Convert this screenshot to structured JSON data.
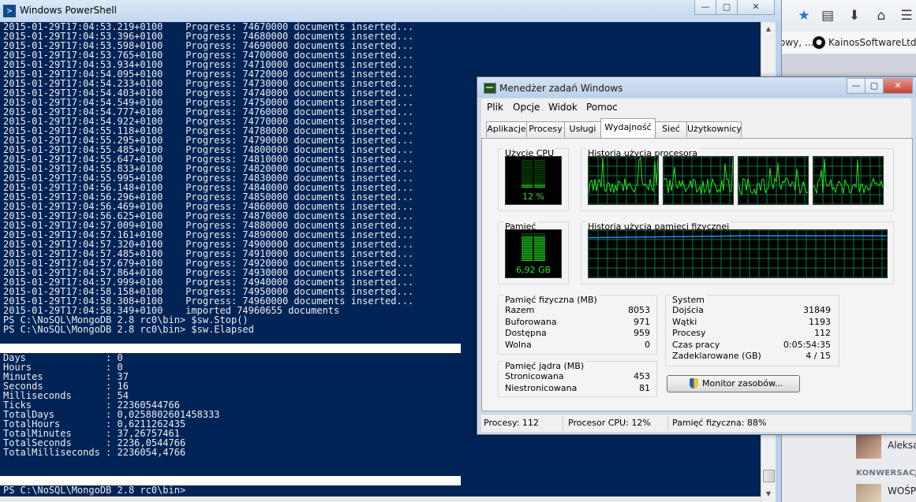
{
  "browser": {
    "bookmark_prefix": "owy, ...",
    "bookmark_github": "KainosSoftwareLtd/t",
    "chat_name_1": "Aleksa",
    "chat_section": "KONWERSACJ",
    "chat_name_2": "WOŚP"
  },
  "powershell": {
    "title": "Windows PowerShell",
    "progress_lines": [
      "2015-01-29T17:04:53.219+0100    Progress: 74670000 documents inserted...",
      "2015-01-29T17:04:53.396+0100    Progress: 74680000 documents inserted...",
      "2015-01-29T17:04:53.598+0100    Progress: 74690000 documents inserted...",
      "2015-01-29T17:04:53.765+0100    Progress: 74700000 documents inserted...",
      "2015-01-29T17:04:53.934+0100    Progress: 74710000 documents inserted...",
      "2015-01-29T17:04:54.095+0100    Progress: 74720000 documents inserted...",
      "2015-01-29T17:04:54.233+0100    Progress: 74730000 documents inserted...",
      "2015-01-29T17:04:54.403+0100    Progress: 74740000 documents inserted...",
      "2015-01-29T17:04:54.549+0100    Progress: 74750000 documents inserted...",
      "2015-01-29T17:04:54.777+0100    Progress: 74760000 documents inserted...",
      "2015-01-29T17:04:54.922+0100    Progress: 74770000 documents inserted...",
      "2015-01-29T17:04:55.118+0100    Progress: 74780000 documents inserted...",
      "2015-01-29T17:04:55.295+0100    Progress: 74790000 documents inserted...",
      "2015-01-29T17:04:55.485+0100    Progress: 74800000 documents inserted...",
      "2015-01-29T17:04:55.647+0100    Progress: 74810000 documents inserted...",
      "2015-01-29T17:04:55.833+0100    Progress: 74820000 documents inserted...",
      "2015-01-29T17:04:55.995+0100    Progress: 74830000 documents inserted...",
      "2015-01-29T17:04:56.148+0100    Progress: 74840000 documents inserted...",
      "2015-01-29T17:04:56.296+0100    Progress: 74850000 documents inserted...",
      "2015-01-29T17:04:56.469+0100    Progress: 74860000 documents inserted...",
      "2015-01-29T17:04:56.625+0100    Progress: 74870000 documents inserted...",
      "2015-01-29T17:04:57.009+0100    Progress: 74880000 documents inserted...",
      "2015-01-29T17:04:57.161+0100    Progress: 74890000 documents inserted...",
      "2015-01-29T17:04:57.320+0100    Progress: 74900000 documents inserted...",
      "2015-01-29T17:04:57.485+0100    Progress: 74910000 documents inserted...",
      "2015-01-29T17:04:57.679+0100    Progress: 74920000 documents inserted...",
      "2015-01-29T17:04:57.864+0100    Progress: 74930000 documents inserted...",
      "2015-01-29T17:04:57.999+0100    Progress: 74940000 documents inserted...",
      "2015-01-29T17:04:58.158+0100    Progress: 74950000 documents inserted...",
      "2015-01-29T17:04:58.308+0100    Progress: 74960000 documents inserted...",
      "2015-01-29T17:04:58.349+0100    imported 74960655 documents"
    ],
    "cmd_stop": "PS C:\\NoSQL\\MongoDB 2.8 rc0\\bin> $sw.Stop()",
    "cmd_elapsed": "PS C:\\NoSQL\\MongoDB 2.8 rc0\\bin> $sw.Elapsed",
    "elapsed_lines": [
      "Days              : 0",
      "Hours             : 0",
      "Minutes           : 37",
      "Seconds           : 16",
      "Milliseconds      : 54",
      "Ticks             : 22360544766",
      "TotalDays         : 0,0258802601458333",
      "TotalHours        : 0,6211262435",
      "TotalMinutes      : 37,26757461",
      "TotalSeconds      : 2236,0544766",
      "TotalMilliseconds : 2236054,4766"
    ],
    "prompt": "PS C:\\NoSQL\\MongoDB 2.8 rc0\\bin>"
  },
  "taskmanager": {
    "title": "Menedżer zadań Windows",
    "menu": [
      "Plik",
      "Opcje",
      "Widok",
      "Pomoc"
    ],
    "tabs": [
      "Aplikacje",
      "Procesy",
      "Usługi",
      "Wydajność",
      "Sieć",
      "Użytkownicy"
    ],
    "active_tab": "Wydajność",
    "cpu_usage_label": "Użycie CPU",
    "cpu_usage_value": "12 %",
    "cpu_usage_level": 0.12,
    "cpu_history_label": "Historia użycia procesora",
    "memory_label": "Pamięć",
    "memory_value": "6,92 GB",
    "memory_level": 0.88,
    "memory_history_label": "Historia użycia pamięci fizycznej",
    "physical_memory": {
      "title": "Pamięć fizyczna (MB)",
      "rows": [
        {
          "label": "Razem",
          "value": "8053"
        },
        {
          "label": "Buforowana",
          "value": "971"
        },
        {
          "label": "Dostępna",
          "value": "959"
        },
        {
          "label": "Wolna",
          "value": "0"
        }
      ]
    },
    "kernel_memory": {
      "title": "Pamięć jądra (MB)",
      "rows": [
        {
          "label": "Stronicowana",
          "value": "453"
        },
        {
          "label": "Niestronicowana",
          "value": "81"
        }
      ]
    },
    "system": {
      "title": "System",
      "rows": [
        {
          "label": "Dojścia",
          "value": "31849"
        },
        {
          "label": "Wątki",
          "value": "1193"
        },
        {
          "label": "Procesy",
          "value": "112"
        },
        {
          "label": "Czas pracy",
          "value": "0:05:54:35"
        },
        {
          "label": "Zadeklarowane (GB)",
          "value": "4 / 15"
        }
      ]
    },
    "resource_monitor_button": "Monitor zasobów...",
    "status": {
      "processes": "Procesy: 112",
      "cpu": "Procesor CPU: 12%",
      "memory": "Pamięć fizyczna: 88%"
    },
    "colors": {
      "graph_line": "#22e522",
      "graph_grid": "#008040",
      "memory_line": "#1e90ff"
    }
  }
}
